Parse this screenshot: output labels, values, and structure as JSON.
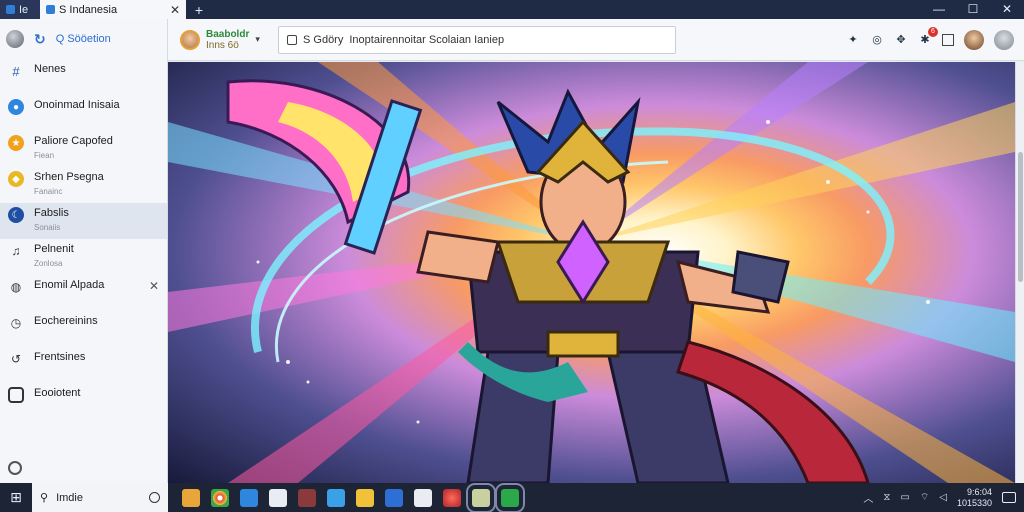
{
  "tabs": [
    {
      "label": "Ie"
    },
    {
      "label": "S Indanesia"
    }
  ],
  "window": {
    "new_tab": "+",
    "minimize": "—",
    "maximize": "☐",
    "close": "✕"
  },
  "sidebar": {
    "search_label": "Q Sööetion",
    "items": [
      {
        "label": "Nenes",
        "sub": ""
      },
      {
        "label": "Onoinmad Inisaia",
        "sub": ""
      },
      {
        "label": "Paliore Capofed",
        "sub": "Fiean"
      },
      {
        "label": "Srhen Psegna",
        "sub": "Fanainc"
      },
      {
        "label": "Fabslis",
        "sub": "Sonaiis"
      },
      {
        "label": "Pelnenit",
        "sub": "Zonlosa"
      },
      {
        "label": "Enomil Alpada",
        "sub": ""
      },
      {
        "label": "Eochereinins",
        "sub": ""
      },
      {
        "label": "Frentsines",
        "sub": ""
      },
      {
        "label": "Eooiotent",
        "sub": ""
      }
    ]
  },
  "toolbar": {
    "profile_name": "Baaboldr",
    "profile_sub": "Inns 6ö",
    "address_prefix": "S Gdöry",
    "address_text": "Inoptairennoitar Scolaian Ianiep",
    "notification_count": "6"
  },
  "taskbar": {
    "search_text": "Imdie",
    "clock_time": "9:6:04",
    "clock_date": "1015330"
  },
  "colors": {
    "tab_bar": "#1f2b45",
    "accent": "#2c6fcf",
    "taskbar": "#1c2436"
  }
}
